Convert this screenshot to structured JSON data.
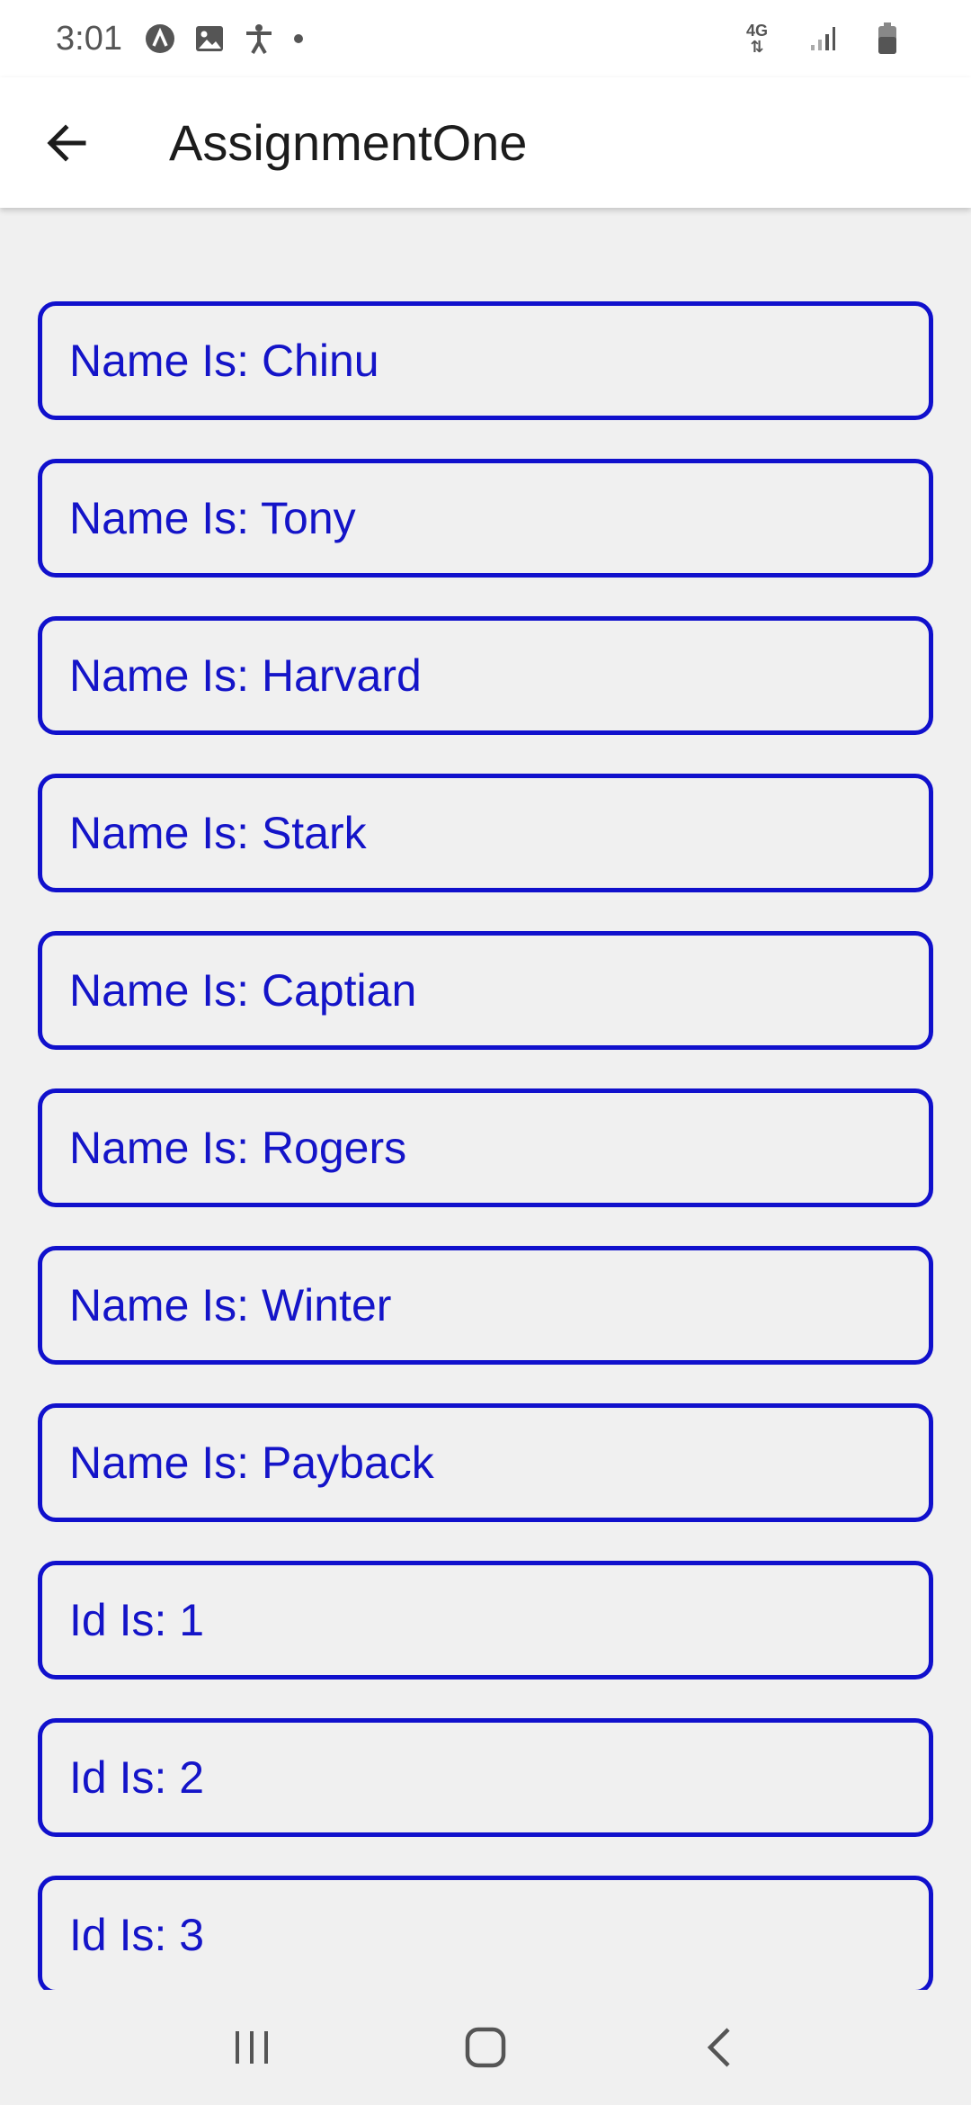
{
  "status_bar": {
    "time": "3:01",
    "network": "4G"
  },
  "app_bar": {
    "title": "AssignmentOne"
  },
  "list": {
    "items": [
      "Name Is: Chinu",
      "Name Is: Tony",
      "Name Is: Harvard",
      "Name Is: Stark",
      "Name Is: Captian",
      "Name Is: Rogers",
      "Name Is: Winter",
      "Name Is: Payback",
      "Id Is: 1",
      "Id Is: 2",
      "Id Is: 3"
    ]
  },
  "colors": {
    "accent": "#1010cc",
    "background": "#f0f0f0"
  },
  "icons": {
    "back": "arrow-left-icon",
    "nav_recent": "recent-apps-icon",
    "nav_home": "home-icon",
    "nav_back": "nav-back-icon"
  }
}
